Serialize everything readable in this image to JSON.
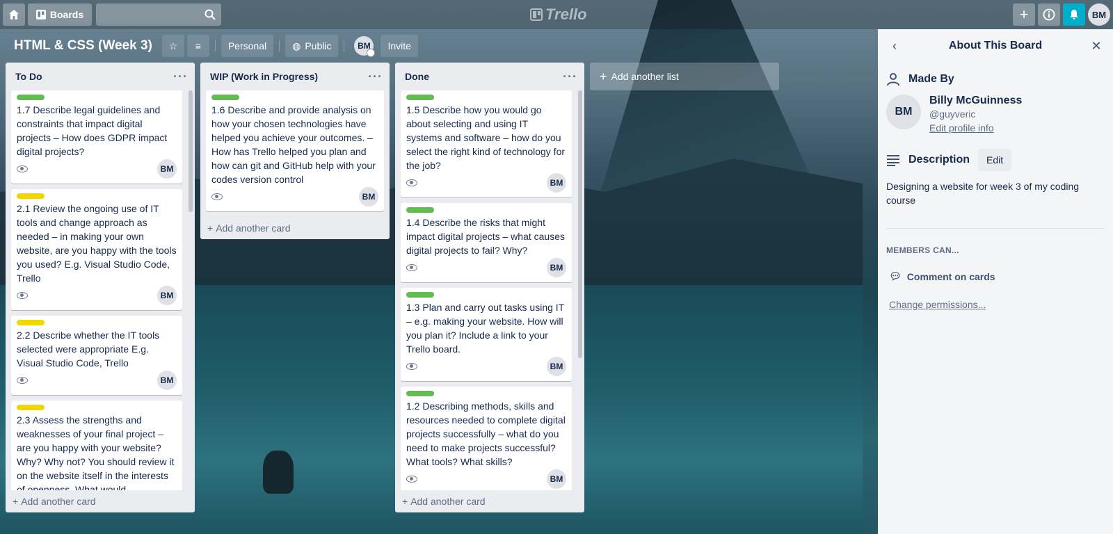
{
  "header": {
    "boards_label": "Boards",
    "logo_text": "Trello",
    "user_initials": "BM"
  },
  "board": {
    "title": "HTML & CSS (Week 3)",
    "team": "Personal",
    "visibility": "Public",
    "member_initials": "BM",
    "invite_label": "Invite"
  },
  "lists": [
    {
      "title": "To Do",
      "add_label": "Add another card",
      "cards": [
        {
          "label": "green",
          "title": "1.7 Describe legal guidelines and constraints that impact digital projects – How does GDPR impact digital projects?",
          "member": "BM"
        },
        {
          "label": "yellow",
          "title": "2.1 Review the ongoing use of IT tools and change approach as needed – in making your own website, are you happy with the tools you used? E.g. Visual Studio Code, Trello",
          "member": "BM"
        },
        {
          "label": "yellow",
          "title": "2.2 Describe whether the IT tools selected were appropriate E.g. Visual Studio Code, Trello",
          "member": "BM"
        },
        {
          "label": "yellow",
          "title": "2.3 Assess the strengths and weaknesses of your final project – are you happy with your website? Why? Why not? You should review it on the website itself in the interests of openness. What would",
          "member": "BM"
        }
      ]
    },
    {
      "title": "WIP (Work in Progress)",
      "add_label": "Add another card",
      "cards": [
        {
          "label": "green",
          "title": "1.6 Describe and provide analysis on how your chosen technologies have helped you achieve your outcomes. – How has Trello helped you plan and how can git and GitHub help with your codes version control",
          "member": "BM"
        }
      ]
    },
    {
      "title": "Done",
      "add_label": "Add another card",
      "cards": [
        {
          "label": "green",
          "title": "1.5 Describe how you would go about selecting and using IT systems and software – how do you select the right kind of technology for the job?",
          "member": "BM"
        },
        {
          "label": "green",
          "title": "1.4 Describe the risks that might impact digital projects – what causes digital projects to fail? Why?",
          "member": "BM"
        },
        {
          "label": "green",
          "title": "1.3 Plan and carry out tasks using IT – e.g. making your website. How will you plan it? Include a link to your Trello board.",
          "member": "BM"
        },
        {
          "label": "green",
          "title": "1.2 Describing methods, skills and resources needed to complete digital projects successfully – what do you need to make projects successful? What tools? What skills?",
          "member": "BM"
        }
      ]
    }
  ],
  "add_list_label": "Add another list",
  "sidebar": {
    "title": "About This Board",
    "made_by": "Made By",
    "avatar": "BM",
    "name": "Billy McGuinness",
    "username": "@guyveric",
    "edit_profile": "Edit profile info",
    "description_heading": "Description",
    "edit_label": "Edit",
    "description": "Designing a website for week 3 of my coding course",
    "members_can": "MEMBERS CAN...",
    "permission": "Comment on cards",
    "change_permissions": "Change permissions..."
  },
  "colors": {
    "green": "#61bd4f",
    "yellow": "#f2d600",
    "notification": "#00aecc"
  }
}
